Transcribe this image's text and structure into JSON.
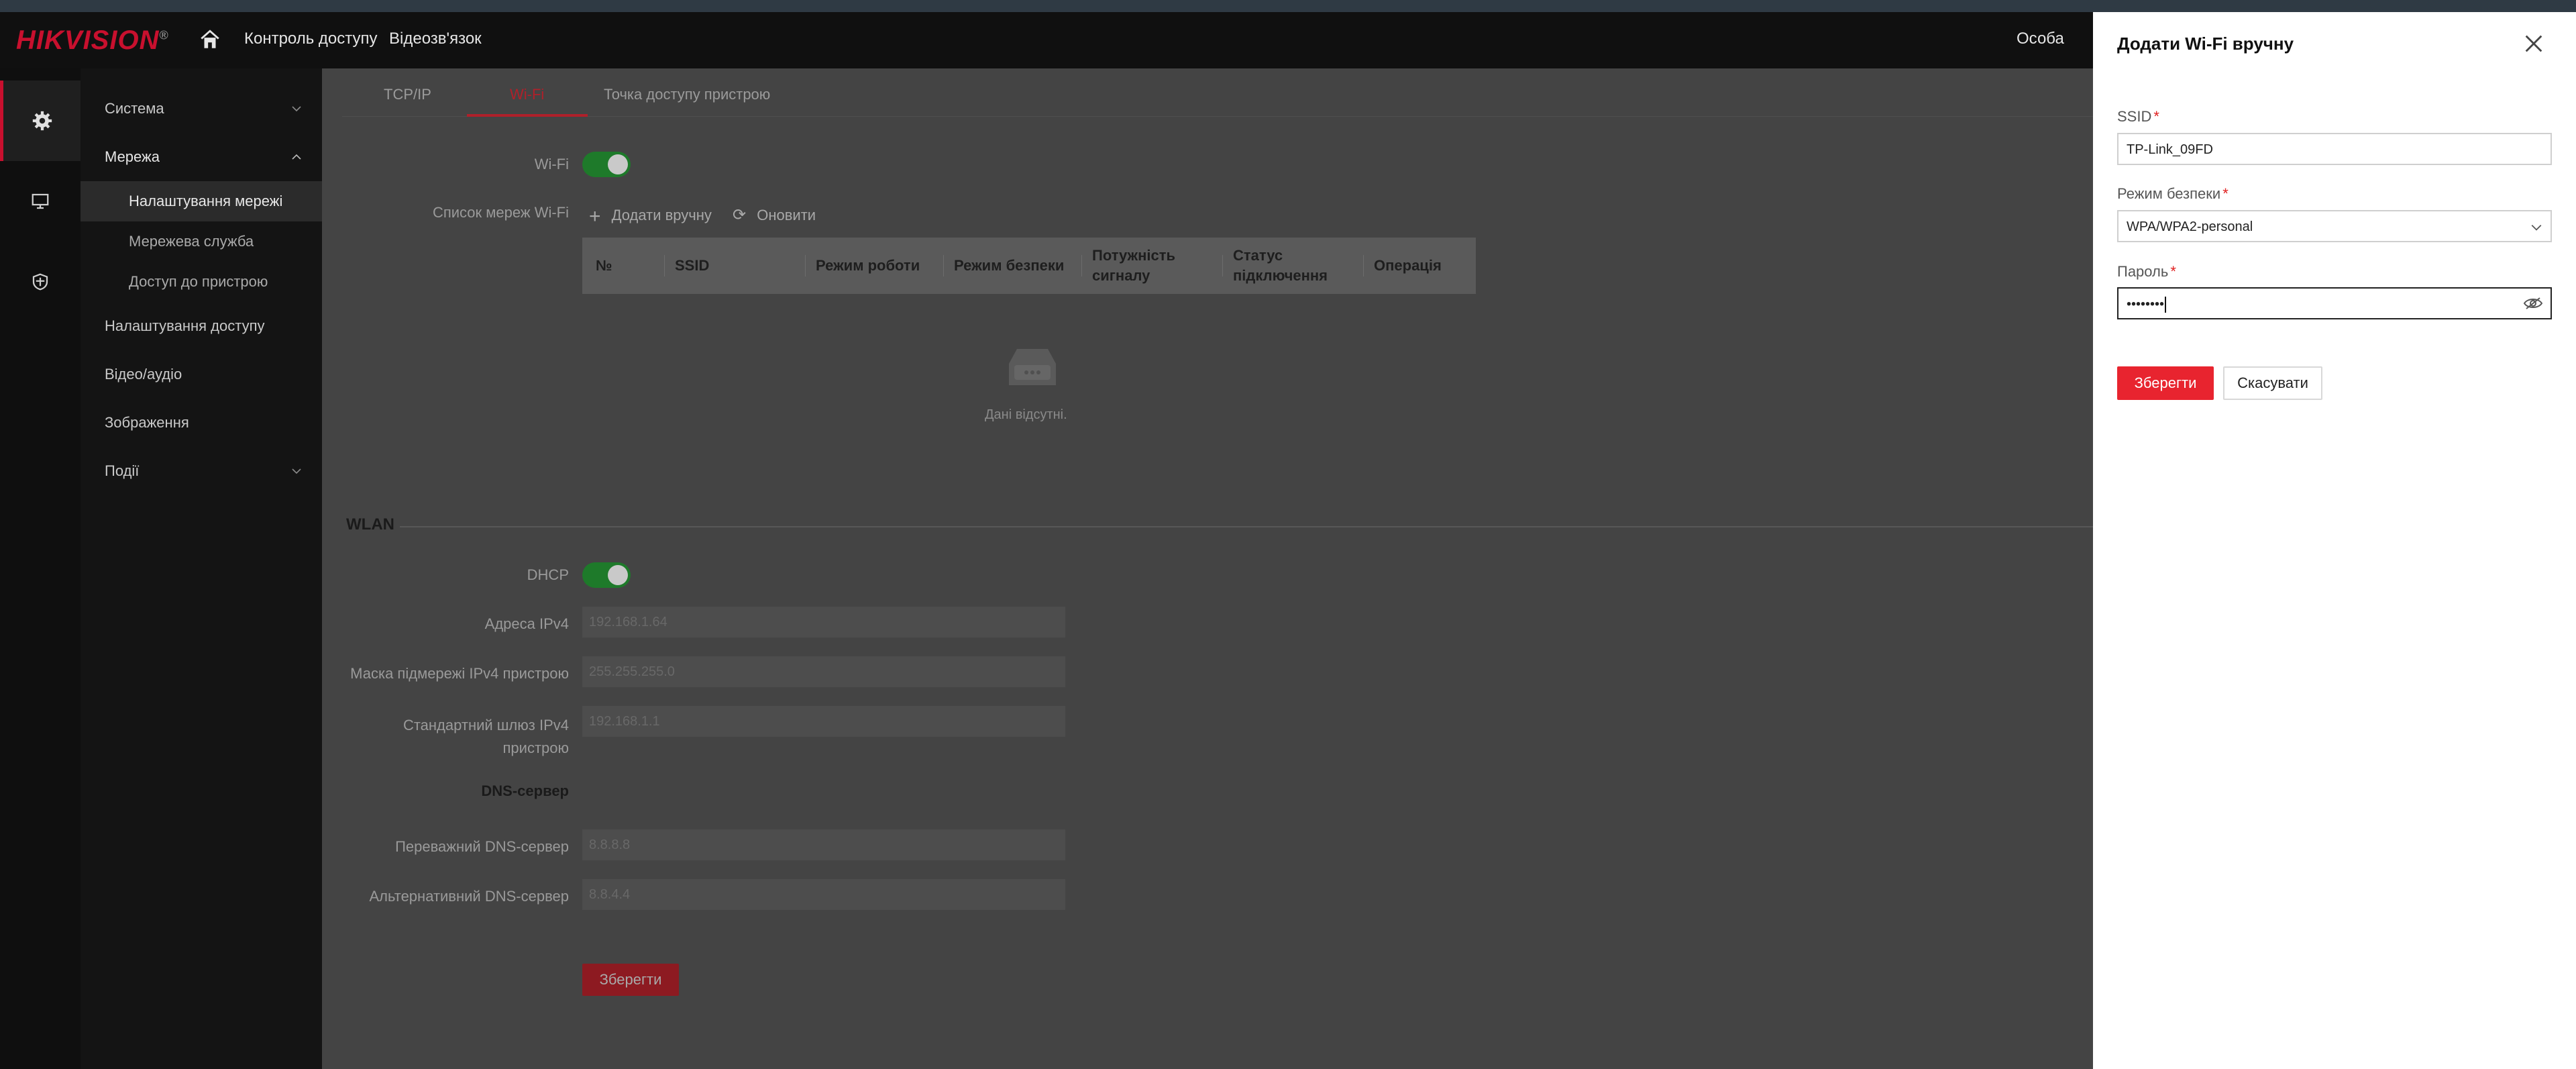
{
  "header": {
    "logo": "HIKVISION",
    "nav": [
      "Контроль доступу",
      "Відеозв'язок"
    ],
    "user": "Особа"
  },
  "rail": {
    "icons": [
      "gear-icon",
      "monitor-icon",
      "shield-icon"
    ]
  },
  "sidebar": {
    "items": [
      {
        "label": "Система"
      },
      {
        "label": "Мережа"
      },
      {
        "label": "Налаштування мережі"
      },
      {
        "label": "Мережева служба"
      },
      {
        "label": "Доступ до пристрою"
      },
      {
        "label": "Налаштування доступу"
      },
      {
        "label": "Відео/аудіо"
      },
      {
        "label": "Зображення"
      },
      {
        "label": "Події"
      }
    ]
  },
  "main": {
    "tabs": [
      "TCP/IP",
      "Wi-Fi",
      "Точка доступу пристрою"
    ],
    "wifi_label": "Wi-Fi",
    "wifi_list_label": "Список мереж Wi-Fi",
    "add_manual": "Додати вручну",
    "refresh": "Оновити",
    "table_headers": [
      "№",
      "SSID",
      "Режим роботи",
      "Режим безпеки",
      "Потужність сигналу",
      "Статус підключення",
      "Операція"
    ],
    "empty_text": "Дані відсутні.",
    "wlan_title": "WLAN",
    "dhcp_label": "DHCP",
    "ipv4_label": "Адреса IPv4",
    "ipv4_value": "192.168.1.64",
    "mask_label": "Маска підмережі IPv4 пристрою",
    "mask_value": "255.255.255.0",
    "gateway_label": "Стандартний шлюз IPv4 пристрою",
    "gateway_value": "192.168.1.1",
    "dns_title": "DNS-сервер",
    "dns_pref_label": "Переважний DNS-сервер",
    "dns_pref_value": "8.8.8.8",
    "dns_alt_label": "Альтернативний DNS-сервер",
    "dns_alt_value": "8.8.4.4",
    "save": "Зберегти"
  },
  "drawer": {
    "title": "Додати Wi-Fi вручну",
    "ssid_label": "SSID",
    "ssid_value": "TP-Link_09FD",
    "security_label": "Режим безпеки",
    "security_value": "WPA/WPA2-personal",
    "password_label": "Пароль",
    "password_value": "••••••••",
    "save": "Зберегти",
    "cancel": "Скасувати"
  },
  "colors": {
    "accent": "#e8242f",
    "toggle_on": "#1e7a2a"
  }
}
